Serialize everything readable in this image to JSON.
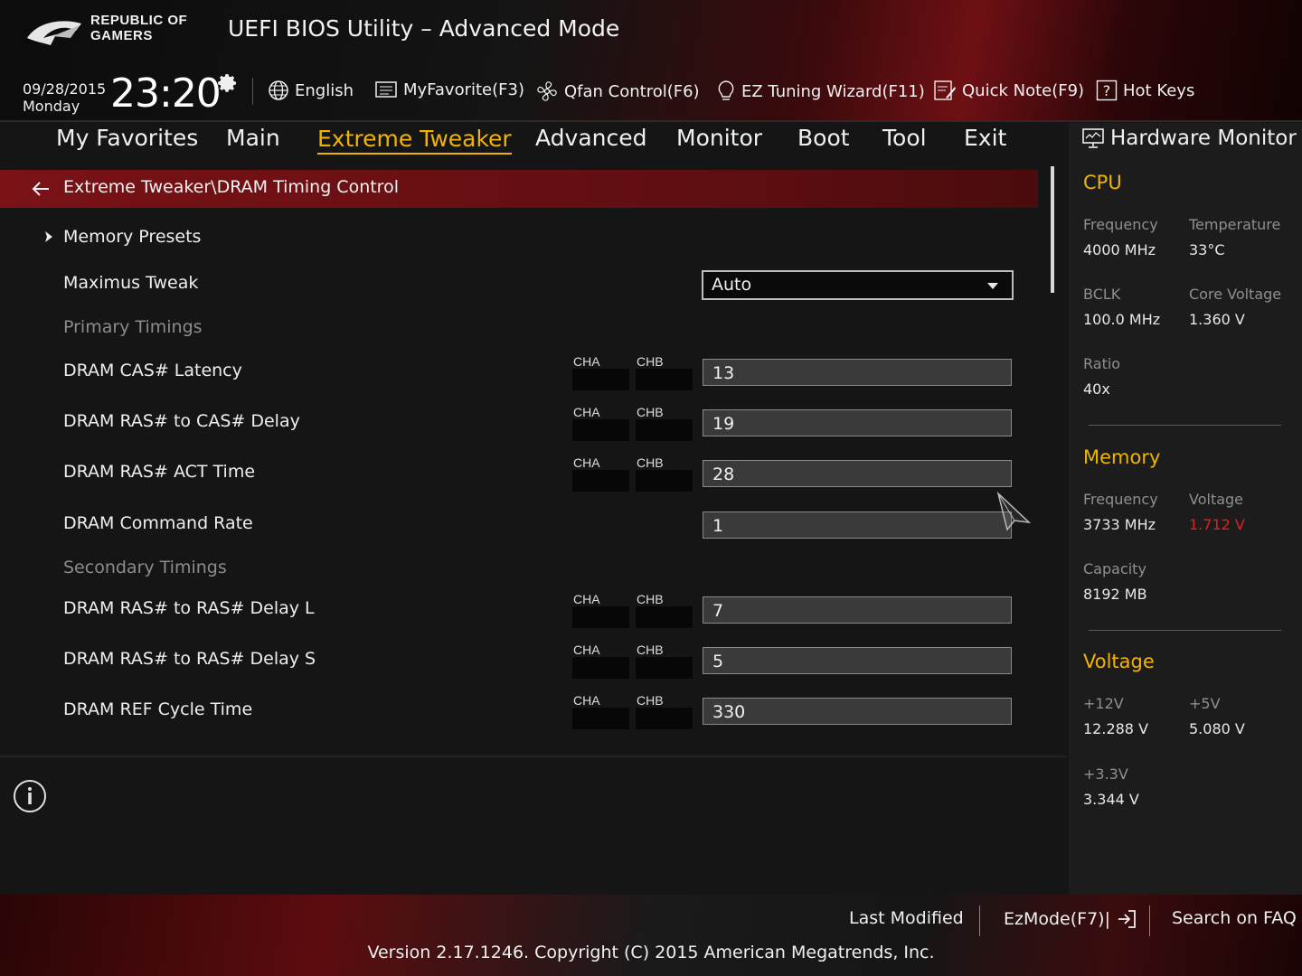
{
  "header": {
    "brand_line1": "REPUBLIC OF",
    "brand_line2": "GAMERS",
    "title": "UEFI BIOS Utility – Advanced Mode",
    "date": "09/28/2015",
    "day": "Monday",
    "time": "23:20",
    "tools": [
      {
        "label": "English",
        "icon": "globe-icon"
      },
      {
        "label": "MyFavorite(F3)",
        "icon": "favorite-list-icon"
      },
      {
        "label": "Qfan Control(F6)",
        "icon": "fan-icon"
      },
      {
        "label": "EZ Tuning Wizard(F11)",
        "icon": "lightbulb-icon"
      },
      {
        "label": "Quick Note(F9)",
        "icon": "note-icon"
      },
      {
        "label": "Hot Keys",
        "icon": "question-box-icon"
      }
    ]
  },
  "nav": {
    "tabs": [
      "My Favorites",
      "Main",
      "Extreme Tweaker",
      "Advanced",
      "Monitor",
      "Boot",
      "Tool",
      "Exit"
    ],
    "active": "Extreme Tweaker"
  },
  "breadcrumb": "Extreme Tweaker\\DRAM Timing Control",
  "settings": {
    "memory_presets": "Memory Presets",
    "maximus_tweak": {
      "label": "Maximus Tweak",
      "value": "Auto"
    },
    "primary_header": "Primary Timings",
    "secondary_header": "Secondary Timings",
    "cha": "CHA",
    "chb": "CHB",
    "rows": [
      {
        "label": "DRAM CAS# Latency",
        "value": "13"
      },
      {
        "label": "DRAM RAS# to CAS# Delay",
        "value": "19"
      },
      {
        "label": "DRAM RAS# ACT Time",
        "value": "28"
      },
      {
        "label": "DRAM Command Rate",
        "value": "1"
      },
      {
        "label": "DRAM RAS# to RAS# Delay L",
        "value": "7"
      },
      {
        "label": "DRAM RAS# to RAS# Delay S",
        "value": "5"
      },
      {
        "label": "DRAM REF Cycle Time",
        "value": "330"
      }
    ]
  },
  "hw": {
    "title": "Hardware Monitor",
    "cpu": {
      "title": "CPU",
      "frequency_label": "Frequency",
      "frequency": "4000 MHz",
      "temperature_label": "Temperature",
      "temperature": "33°C",
      "bclk_label": "BCLK",
      "bclk": "100.0 MHz",
      "core_voltage_label": "Core Voltage",
      "core_voltage": "1.360 V",
      "ratio_label": "Ratio",
      "ratio": "40x"
    },
    "memory": {
      "title": "Memory",
      "frequency_label": "Frequency",
      "frequency": "3733 MHz",
      "voltage_label": "Voltage",
      "voltage": "1.712 V",
      "capacity_label": "Capacity",
      "capacity": "8192 MB"
    },
    "voltage": {
      "title": "Voltage",
      "v12_label": "+12V",
      "v12": "12.288 V",
      "v5_label": "+5V",
      "v5": "5.080 V",
      "v33_label": "+3.3V",
      "v33": "3.344 V"
    }
  },
  "footer": {
    "last_modified": "Last Modified",
    "ezmode": "EzMode(F7)|",
    "search_faq": "Search on FAQ",
    "version": "Version 2.17.1246. Copyright (C) 2015 American Megatrends, Inc."
  },
  "colors": {
    "accent": "#f0b400",
    "breadcrumb_bg": "#7a1216",
    "warning_red": "#e02020"
  }
}
